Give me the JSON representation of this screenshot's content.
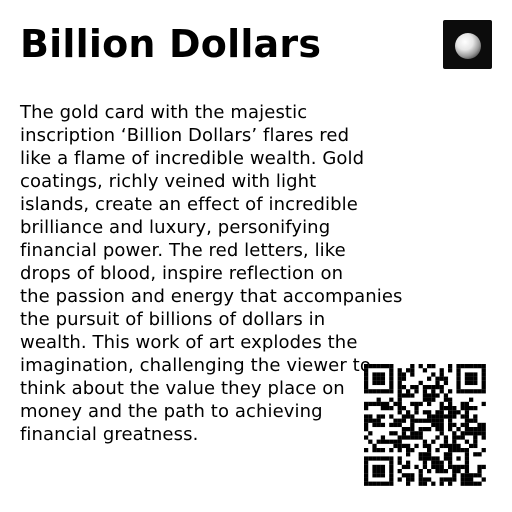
{
  "header": {
    "title": "Billion Dollars",
    "logo_icon": "pearl-logo-icon"
  },
  "description": {
    "lines": [
      "The gold card with the majestic",
      "inscription ‘Billion Dollars’ flares red",
      "like a flame of incredible wealth. Gold",
      "coatings, richly veined with light",
      "islands, create an effect of incredible",
      "brilliance and luxury, personifying",
      "financial power. The red letters, like",
      "drops of blood, inspire reflection on",
      "the passion and energy that accompanies",
      "the pursuit of billions of dollars in",
      "wealth. This work of art explodes the",
      "imagination, challenging the viewer to",
      "think about the value they place on",
      "money and the path to achieving",
      "financial greatness."
    ]
  },
  "qr_code": {
    "icon": "qr-code-icon"
  },
  "colors": {
    "text": "#000000",
    "background": "#ffffff",
    "logo_background": "#0c0c0c"
  }
}
